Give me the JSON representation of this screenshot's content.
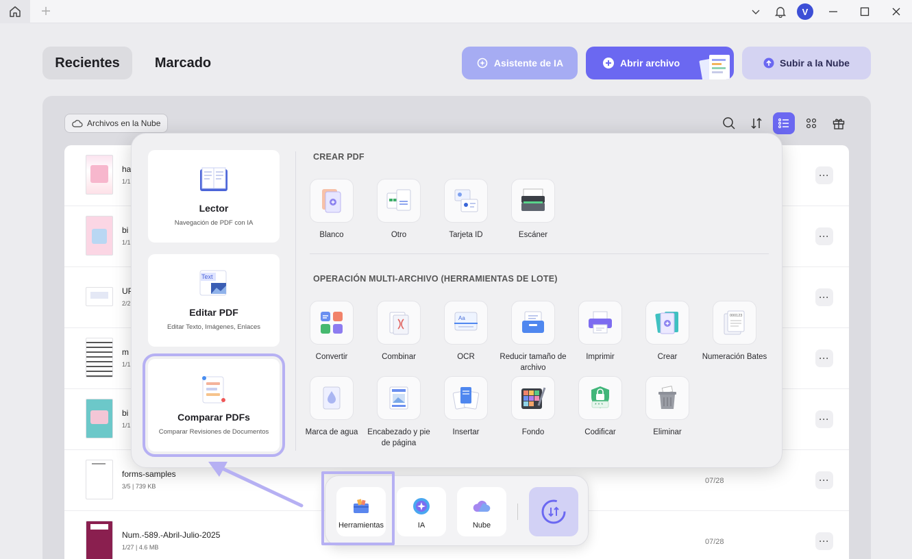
{
  "titlebar": {
    "avatar_letter": "V"
  },
  "tabs": [
    {
      "label": "Recientes",
      "active": true
    },
    {
      "label": "Marcado",
      "active": false
    }
  ],
  "buttons": {
    "ai": "Asistente de IA",
    "open": "Abrir archivo",
    "cloud": "Subir a la Nube"
  },
  "cloud_chip": "Archivos en la Nube",
  "files": [
    {
      "name": "ha",
      "meta": "1/1",
      "date": ""
    },
    {
      "name": "bi",
      "meta": "1/1",
      "date": ""
    },
    {
      "name": "UP",
      "meta": "2/2",
      "date": ""
    },
    {
      "name": "m",
      "meta": "1/1",
      "date": ""
    },
    {
      "name": "bi",
      "meta": "1/1",
      "date": ""
    },
    {
      "name": "forms-samples",
      "meta": "3/5 | 739 KB",
      "date": "07/28"
    },
    {
      "name": "Num.-589.-Abril-Julio-2025",
      "meta": "1/27 | 4.6 MB",
      "date": "07/28"
    }
  ],
  "popup": {
    "cards": [
      {
        "title": "Lector",
        "subtitle": "Navegación de PDF con IA"
      },
      {
        "title": "Editar PDF",
        "subtitle": "Editar Texto, Imágenes, Enlaces",
        "icon_text": "Text"
      },
      {
        "title": "Comparar PDFs",
        "subtitle": "Comparar Revisiones de Documentos"
      }
    ],
    "create_section": "CREAR PDF",
    "create_tools": [
      {
        "label": "Blanco",
        "icon": "blank-page-icon"
      },
      {
        "label": "Otro",
        "icon": "other-file-icon"
      },
      {
        "label": "Tarjeta ID",
        "icon": "id-card-icon"
      },
      {
        "label": "Escáner",
        "icon": "scanner-icon"
      }
    ],
    "batch_section": "OPERACIÓN MULTI-ARCHIVO (HERRAMIENTAS DE LOTE)",
    "batch_tools_row1": [
      {
        "label": "Convertir",
        "icon": "convert-icon"
      },
      {
        "label": "Combinar",
        "icon": "combine-icon"
      },
      {
        "label": "OCR",
        "icon": "ocr-icon"
      },
      {
        "label": "Reducir tamaño de archivo",
        "icon": "compress-icon"
      },
      {
        "label": "Imprimir",
        "icon": "print-icon"
      },
      {
        "label": "Crear",
        "icon": "create-icon"
      },
      {
        "label": "Numeración Bates",
        "icon": "bates-icon"
      }
    ],
    "batch_tools_row2": [
      {
        "label": "Marca de agua",
        "icon": "watermark-icon"
      },
      {
        "label": "Encabezado y pie de página",
        "icon": "header-footer-icon"
      },
      {
        "label": "Insertar",
        "icon": "insert-icon"
      },
      {
        "label": "Fondo",
        "icon": "background-icon"
      },
      {
        "label": "Codificar",
        "icon": "encrypt-icon"
      },
      {
        "label": "Eliminar",
        "icon": "trash-icon"
      }
    ]
  },
  "dock": {
    "tools": "Herramientas",
    "ai": "IA",
    "cloud": "Nube"
  },
  "colors": {
    "accent": "#6b68f1",
    "highlight": "#b6b0f3"
  }
}
